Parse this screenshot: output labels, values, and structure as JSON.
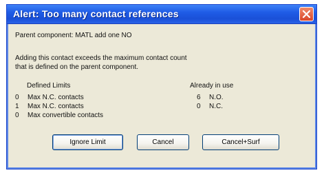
{
  "dialog": {
    "title": "Alert: Too many contact references",
    "parent_component": "Parent component: MATL add one NO",
    "message_line1": "Adding this contact exceeds the maximum contact count",
    "message_line2": "that is defined on the parent component.",
    "defined_limits": {
      "header": "Defined Limits",
      "rows": [
        {
          "value": "0",
          "label": "Max N.C. contacts"
        },
        {
          "value": "1",
          "label": "Max N.C. contacts"
        },
        {
          "value": "0",
          "label": "Max convertible contacts"
        }
      ]
    },
    "already_in_use": {
      "header": "Already in use",
      "rows": [
        {
          "value": "6",
          "label": "N.O."
        },
        {
          "value": "0",
          "label": "N.C."
        }
      ]
    },
    "buttons": {
      "ignore_limit": "Ignore Limit",
      "cancel": "Cancel",
      "cancel_surf": "Cancel+Surf"
    }
  },
  "colors": {
    "titlebar": "#2460e8",
    "dialog_bg": "#ece9d8",
    "close_button": "#e05a3a"
  },
  "icons": {
    "close": "close-icon"
  }
}
